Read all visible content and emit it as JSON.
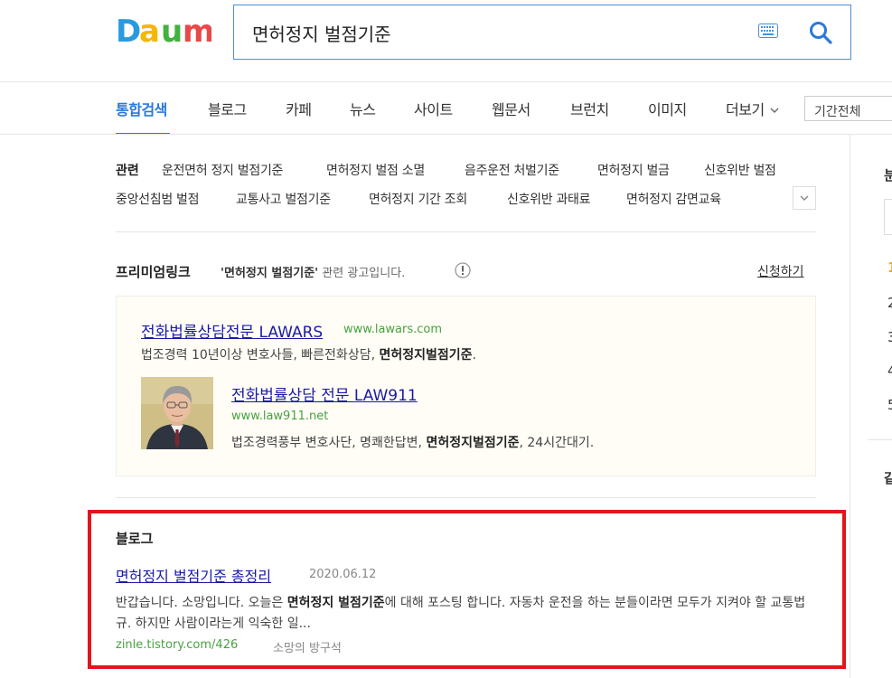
{
  "logo": {
    "letters": [
      "D",
      "a",
      "u",
      "m"
    ],
    "colors": [
      "#2a9ae0",
      "#f5b700",
      "#43b13e",
      "#e8484a"
    ]
  },
  "search": {
    "query": "면허정지 벌점기준"
  },
  "nav": {
    "tabs": [
      "통합검색",
      "블로그",
      "카페",
      "뉴스",
      "사이트",
      "웹문서",
      "브런치",
      "이미지",
      "더보기"
    ],
    "period": "기간전체"
  },
  "related": {
    "title": "관련",
    "links": [
      "운전면허 정지 벌점기준",
      "면허정지 벌점 소멸",
      "음주운전 처벌기준",
      "면허정지 벌금",
      "신호위반 벌점",
      "중앙선침범 벌점",
      "교통사고 벌점기준",
      "면허정지 기간 조회",
      "신호위반 과태료",
      "면허정지 감면교육"
    ]
  },
  "premium": {
    "title": "프리미엄링크",
    "desc_keyword": "'면허정지 벌점기준'",
    "desc_suffix": " 관련 광고입니다.",
    "apply": "신청하기",
    "ads": [
      {
        "title": "전화법률상담전문 LAWARS",
        "url": "www.lawars.com",
        "desc_pre": "법조경력 10년이상 변호사들, 빠른전화상담, ",
        "desc_bold": "면허정지벌점기준",
        "desc_post": "."
      },
      {
        "title": "전화법률상담 전문 LAW911",
        "url": "www.law911.net",
        "desc_pre": "법조경력풍부 변호사단, 명쾌한답변, ",
        "desc_bold": "면허정지벌점기준",
        "desc_post": ", 24시간대기."
      }
    ]
  },
  "blog": {
    "section_title": "블로그",
    "title": "면허정지 벌점기준 총정리",
    "date": "2020.06.12",
    "desc_pre": "반갑습니다. 소망입니다. 오늘은 ",
    "desc_bold": "면허정지 벌점기준",
    "desc_post": "에 대해 포스팅 합니다. 자동차 운전을 하는 분들이라면 모두가 지켜야 할 교통법규. 하지만 사람이라는게 익숙한 일...",
    "url_pre": "zinle.",
    "url_bold": "tistory.com",
    "url_post": "/426",
    "author": "소망의 방구석"
  },
  "right_column": {
    "fragments": [
      "분",
      "1",
      "2",
      "3",
      "4",
      "5",
      "같"
    ]
  },
  "colors": {
    "accent": "#2a7ad8",
    "link": "#1a1aa6",
    "url": "#48a23f",
    "highlight": "#e3151a"
  }
}
